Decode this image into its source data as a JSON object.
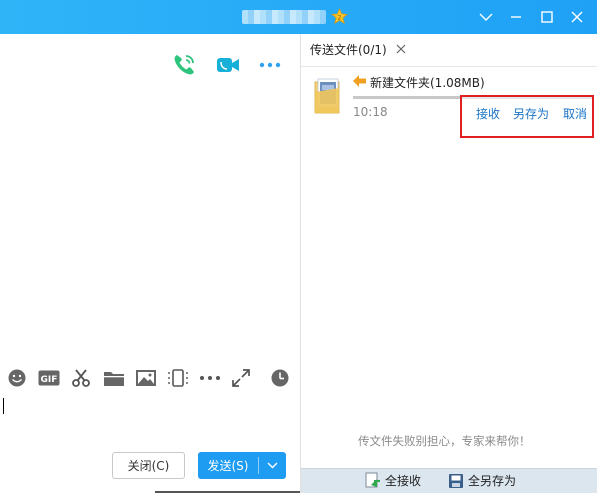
{
  "window": {
    "title_badge_glyph": "2",
    "controls": [
      "chevron-down-icon",
      "minimize-icon",
      "maximize-icon",
      "close-icon"
    ]
  },
  "chat": {
    "toolbar_icons": [
      "emoji-icon",
      "gif-icon",
      "scissors-icon",
      "folder-icon",
      "image-icon",
      "shake-icon",
      "more-icon",
      "expand-icon",
      "clock-icon"
    ],
    "gif_label": "GIF",
    "close_button": "关闭(C)",
    "send_button": "发送(S)"
  },
  "transfer": {
    "tab_label": "传送文件(0/1)",
    "file": {
      "name": "新建文件夹(1.08MB)",
      "time": "10:18",
      "progress": 0.45
    },
    "actions": {
      "receive": "接收",
      "save_as": "另存为",
      "cancel": "取消"
    },
    "hint": "传文件失败别担心，专家来帮你！",
    "bottom": {
      "receive_all": "全接收",
      "save_all": "全另存为"
    }
  },
  "colors": {
    "titlebar": "#1fa1f6",
    "accent": "#1e9cf2",
    "link": "#1a73c8",
    "highlight": "#e02020",
    "phone_green": "#2fc47d",
    "video_teal": "#18b0d8"
  }
}
